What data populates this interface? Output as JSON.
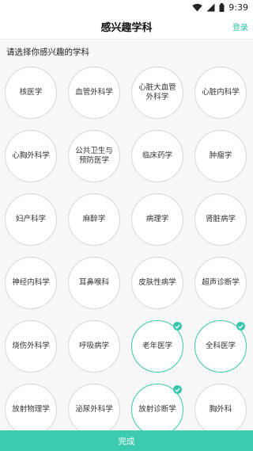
{
  "status_bar": {
    "time": "9:39"
  },
  "header": {
    "title": "感兴趣学科",
    "login_label": "登录"
  },
  "prompt": "请选择你感兴趣的学科",
  "subjects": [
    {
      "label": "核医学",
      "selected": false
    },
    {
      "label": "血管外科学",
      "selected": false
    },
    {
      "label": "心脏大血管外科学",
      "selected": false
    },
    {
      "label": "心脏内科学",
      "selected": false
    },
    {
      "label": "心胸外科学",
      "selected": false
    },
    {
      "label": "公共卫生与预防医学",
      "selected": false
    },
    {
      "label": "临床药学",
      "selected": false
    },
    {
      "label": "肿瘤学",
      "selected": false
    },
    {
      "label": "妇产科学",
      "selected": false
    },
    {
      "label": "麻醉学",
      "selected": false
    },
    {
      "label": "病理学",
      "selected": false
    },
    {
      "label": "肾脏病学",
      "selected": false
    },
    {
      "label": "神经内科学",
      "selected": false
    },
    {
      "label": "耳鼻喉科",
      "selected": false
    },
    {
      "label": "皮肤性病学",
      "selected": false
    },
    {
      "label": "超声诊断学",
      "selected": false
    },
    {
      "label": "烧伤外科学",
      "selected": false
    },
    {
      "label": "呼吸病学",
      "selected": false
    },
    {
      "label": "老年医学",
      "selected": true
    },
    {
      "label": "全科医学",
      "selected": true
    },
    {
      "label": "放射物理学",
      "selected": false
    },
    {
      "label": "泌尿外科学",
      "selected": false
    },
    {
      "label": "放射诊断学",
      "selected": true
    },
    {
      "label": "胸外科",
      "selected": false
    }
  ],
  "footer": {
    "done_label": "完成"
  },
  "colors": {
    "accent": "#3ccbb0",
    "border": "#d6d6d6"
  }
}
